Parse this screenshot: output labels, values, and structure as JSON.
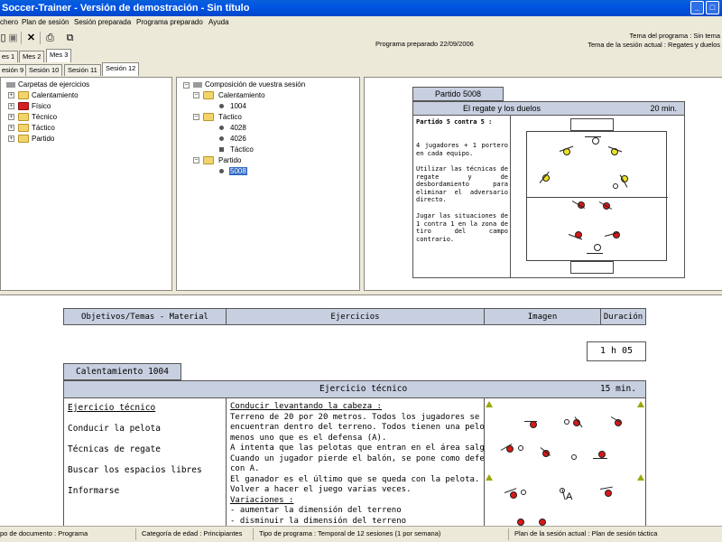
{
  "window": {
    "title": "Soccer-Trainer - Versión de demostración - Sin título"
  },
  "menu": [
    "chero",
    "Plan de sesión",
    "Sesión preparada",
    "Programa preparado",
    "Ayuda"
  ],
  "toolbar_icons": [
    "new-doc-icon",
    "save-icon",
    "delete-icon",
    "print-icon",
    "export-icon"
  ],
  "header": {
    "program_prepared": "Programa preparado 22/09/2006",
    "program_theme": "Tema del programa : Sin tema",
    "session_theme": "Tema de la sesión actual : Regates y duelos"
  },
  "month_tabs": [
    "es 1",
    "Mes 2",
    "Mes 3"
  ],
  "session_tabs": [
    "esión 9",
    "Sesión 10",
    "Sesión 11",
    "Sesión 12"
  ],
  "left_tree": {
    "root": "Carpetas de ejercicios",
    "folders": [
      "Calentamiento",
      "Físico",
      "Técnico",
      "Táctico",
      "Partido"
    ]
  },
  "mid_tree": {
    "root": "Composición de vuestra sesión",
    "groups": [
      {
        "label": "Calentamiento",
        "items": [
          {
            "label": "1004",
            "marker": "dot"
          }
        ]
      },
      {
        "label": "Táctico",
        "items": [
          {
            "label": "4028",
            "marker": "dot"
          },
          {
            "label": "4026",
            "marker": "dot"
          },
          {
            "label": "Táctico",
            "marker": "square"
          }
        ]
      },
      {
        "label": "Partido",
        "items": [
          {
            "label": "5008",
            "marker": "dot",
            "selected": true
          }
        ]
      }
    ]
  },
  "preview": {
    "tab": "Partido 5008",
    "title": "El regate y los duelos",
    "duration": "20 min.",
    "heading": "Partido 5 contra 5 :",
    "paragraphs": [
      "4 jugadores + 1 portero en cada equipo.",
      "Utilizar las técnicas de regate y de desbordamiento para eliminar el adversario directo.",
      "Jugar las situaciones de 1 contra 1 en la zona de tiro del campo contrario."
    ]
  },
  "columns": {
    "objectives": "Objetivos/Temas - Material",
    "exercises": "Ejercicios",
    "image": "Imagen",
    "duration": "Duración"
  },
  "total_duration": "1 h 05",
  "warmup": {
    "tab": "Calentamiento 1004",
    "section_title": "Ejercicio técnico",
    "duration": "15 min.",
    "objectives": [
      "Ejercicio técnico",
      "Conducir la pelota",
      "Técnicas de regate",
      "Buscar los espacios libres",
      "Informarse"
    ],
    "exercise_lines": [
      {
        "text": "Conducir levantando la cabeza :",
        "underline": true
      },
      {
        "text": "Terreno de 20 por 20 metros. Todos los jugadores se",
        "underline": false
      },
      {
        "text": "encuentran dentro del terreno. Todos tienen una pelota",
        "underline": false
      },
      {
        "text": "menos uno que es el defensa (A).",
        "underline": false
      },
      {
        "text": "A intenta que las pelotas que entran en el área salgan.",
        "underline": false
      },
      {
        "text": "Cuando un jugador pierde el balón, se pone como defensa",
        "underline": false
      },
      {
        "text": "con A.",
        "underline": false
      },
      {
        "text": "El ganador es el último que se queda con la pelota.",
        "underline": false
      },
      {
        "text": "Volver a hacer el juego varias veces.",
        "underline": false
      },
      {
        "text": "Variaciones :",
        "underline": true
      },
      {
        "text": "- aumentar la dimensión del terreno",
        "underline": false
      },
      {
        "text": "- disminuir la dimensión del terreno",
        "underline": false
      }
    ],
    "defender_label": "A"
  },
  "status": {
    "doc_type": "po de documento : Programa",
    "age": "Categoría de edad : Principiantes",
    "program_type": "Tipo de programa : Temporal de 12 sesiones (1 por semana)",
    "session_plan": "Plan de la sesión actual : Plan de sesión táctica"
  },
  "colors": {
    "titlebar": "#0055e5",
    "header_fill": "#c8cfe0",
    "selection": "#316ac5",
    "yellow_team": "#f0e320",
    "red_team": "#d81818"
  }
}
